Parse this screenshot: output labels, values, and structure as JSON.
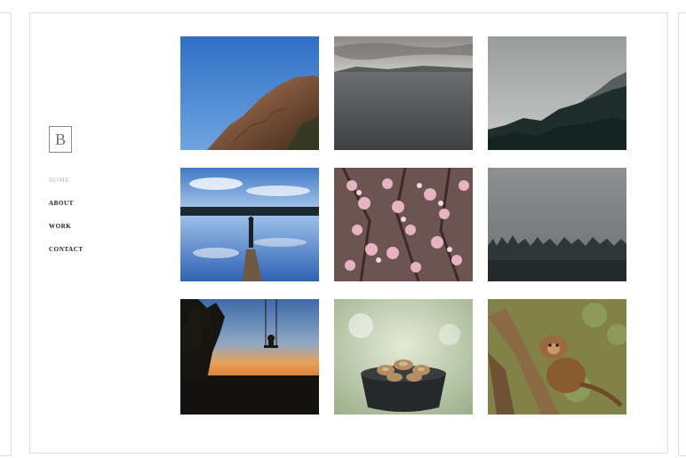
{
  "logo": {
    "letter": "B"
  },
  "nav": {
    "items": [
      {
        "label": "HOME",
        "active": true
      },
      {
        "label": "ABOUT",
        "active": false
      },
      {
        "label": "WORK",
        "active": false
      },
      {
        "label": "CONTACT",
        "active": false
      }
    ]
  },
  "gallery": {
    "photos": [
      {
        "subject": "granite-cliff-blue-sky"
      },
      {
        "subject": "grey-lake-overcast"
      },
      {
        "subject": "misty-pine-forest"
      },
      {
        "subject": "person-on-pier-reflection"
      },
      {
        "subject": "pink-blossom-branches"
      },
      {
        "subject": "foggy-treeline"
      },
      {
        "subject": "swing-at-sunset"
      },
      {
        "subject": "bowl-of-nuts"
      },
      {
        "subject": "monkey-in-tree"
      }
    ]
  }
}
